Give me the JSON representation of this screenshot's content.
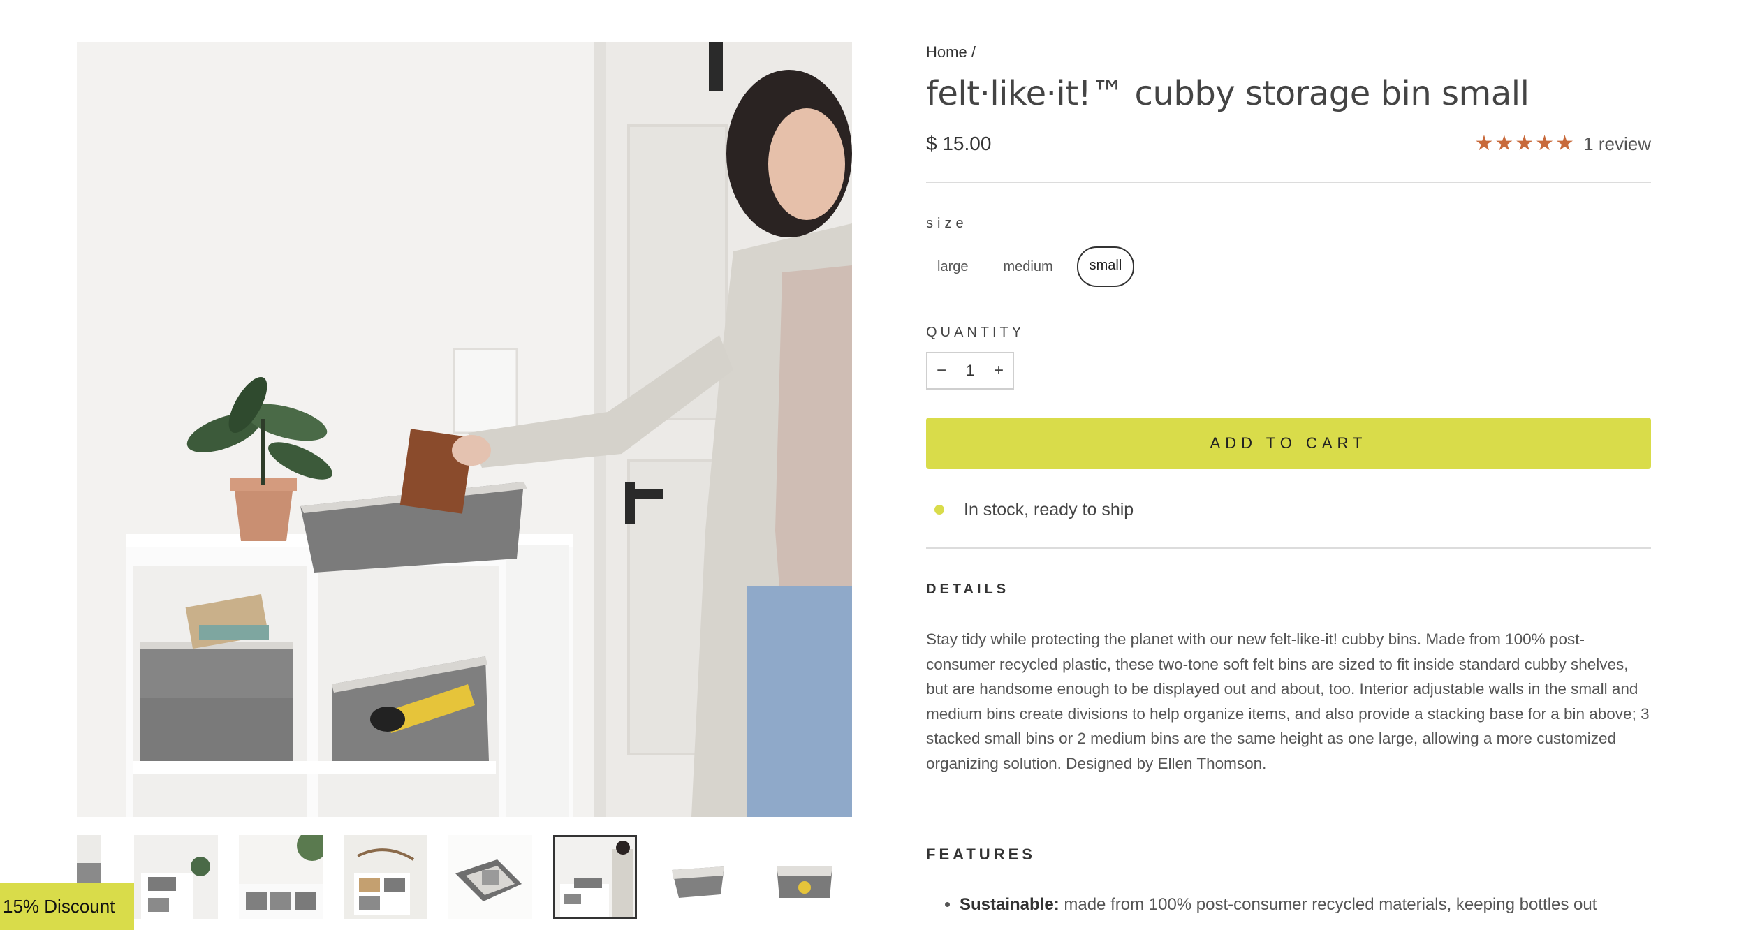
{
  "breadcrumb": {
    "home": "Home",
    "separator": "/"
  },
  "product": {
    "title": "felt·like·it!™ cubby storage bin small",
    "price": "$ 15.00",
    "rating_stars": "★★★★★",
    "rating_value": 5,
    "review_count": "1 review"
  },
  "size": {
    "label": "size",
    "options": [
      "large",
      "medium",
      "small"
    ],
    "selected": "small"
  },
  "quantity": {
    "label": "QUANTITY",
    "minus": "−",
    "plus": "+",
    "value": "1"
  },
  "cart": {
    "add_label": "ADD TO CART"
  },
  "stock": {
    "text": "In stock, ready to ship"
  },
  "details": {
    "label": "DETAILS",
    "text": "Stay tidy while protecting the planet with our new felt-like-it! cubby bins. Made from 100% post-consumer recycled plastic, these two-tone soft felt bins are sized to fit inside standard cubby shelves, but are handsome enough to be displayed out and about, too. Interior adjustable walls in the small and medium bins create divisions to help organize items, and also provide a stacking base for a bin above; 3 stacked small bins or 2 medium bins are the same height as one large, allowing a more customized organizing solution. Designed by Ellen Thomson."
  },
  "features": {
    "label": "FEATURES",
    "items": [
      {
        "title": "Sustainable:",
        "text": " made from 100% post-consumer recycled materials, keeping bottles out"
      }
    ]
  },
  "discount": {
    "label": "15% Discount"
  },
  "gallery": {
    "thumbnail_count": 8,
    "active_index": 5
  },
  "colors": {
    "accent": "#d9dc4a",
    "star": "#c8693a",
    "felt": "#7a7a7a"
  }
}
